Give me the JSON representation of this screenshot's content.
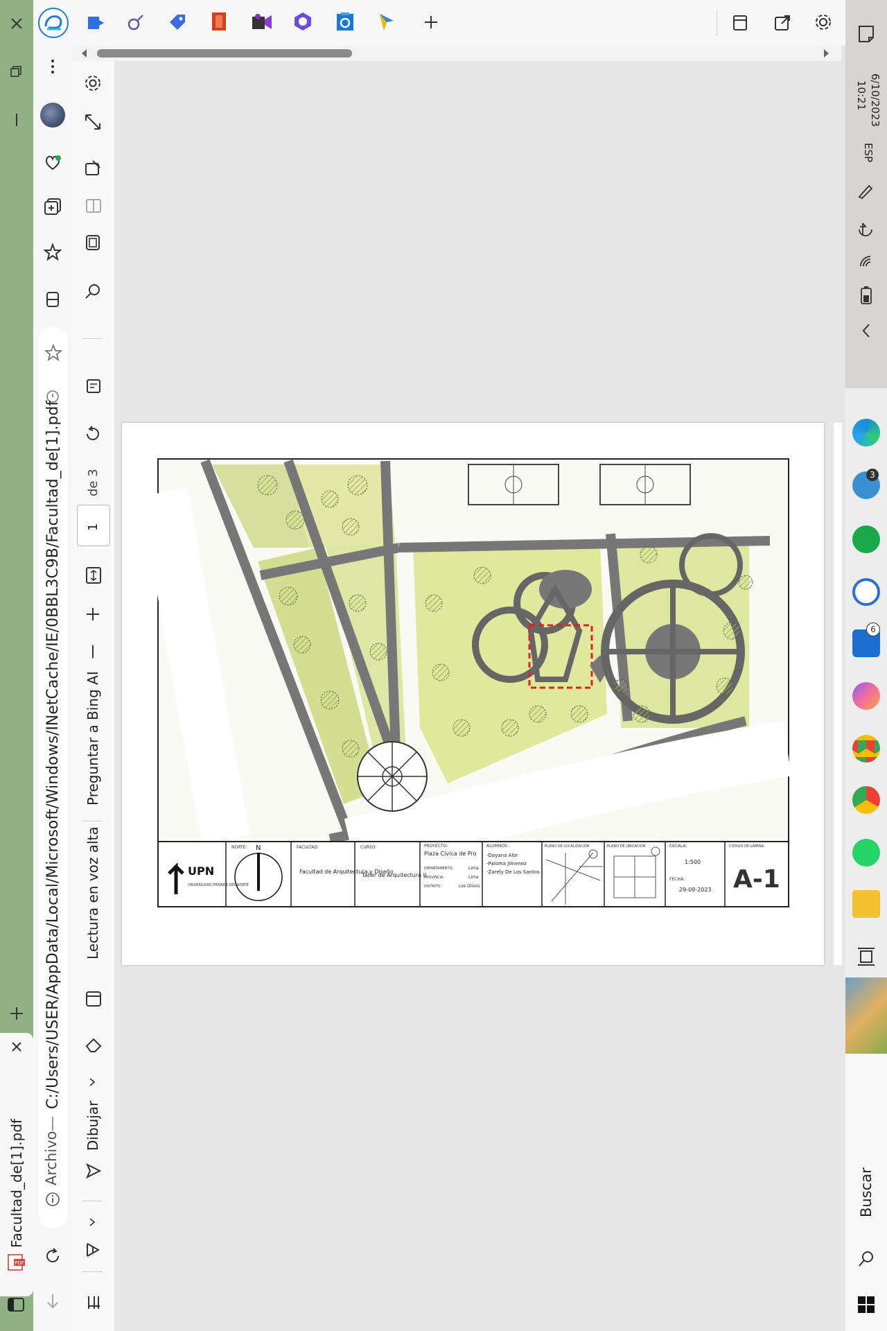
{
  "tab": {
    "title": "Facultad_de[1].pdf"
  },
  "address": {
    "info_label": "Archivo",
    "path": "C:/Users/USER/AppData/Local/Microsoft/Windows/INetCache/IE/0BBL3C9B/Facultad_de[1].pdf"
  },
  "pdf_toolbar": {
    "draw_label": "Dibujar",
    "read_aloud_label": "Lectura en voz alta",
    "ask_bing_label": "Preguntar a Bing AI",
    "page_current": "1",
    "page_total": "de 3"
  },
  "taskbar": {
    "time": "10:21",
    "date": "6/10/2023",
    "language": "ESP",
    "search_label": "Buscar",
    "badge_a": "3",
    "badge_b": "6"
  },
  "drawing": {
    "logo_text": "UPN",
    "logo_subtitle": "UNIVERSIDAD PRIVADA DEL NORTE",
    "north_label": "NORTE:",
    "north_letter": "N",
    "faculty_header": "FACULTAD:",
    "faculty": "Facultad de Arquitectura y Diseño",
    "course_header": "CURSO:",
    "course": "Taller de Arquitectura II",
    "project_header": "PROYECTO:",
    "project": "Plaza Cívica de Pro",
    "department_label": "DEPARTAMENTO:",
    "department": "Lima",
    "province_label": "PROVINCIA:",
    "province": "Lima",
    "district_label": "DISTRITO:",
    "district": "Los Olivos",
    "students_header": "ALUMNOS:",
    "students": [
      "-Dayana Alor",
      "-Paloma Jimenez",
      "-Zarely De Los Santos"
    ],
    "location_plan_header": "PLANO DE LOCALIZACIÓN",
    "site_plan_header": "PLANO DE UBICACIÓN",
    "scale_header": "ESCALA:",
    "scale": "1:500",
    "date_header": "FECHA:",
    "date": "29-09-2023",
    "sheet_header": "CÓDIGO DE LÁMINA",
    "sheet_code": "A-1"
  }
}
